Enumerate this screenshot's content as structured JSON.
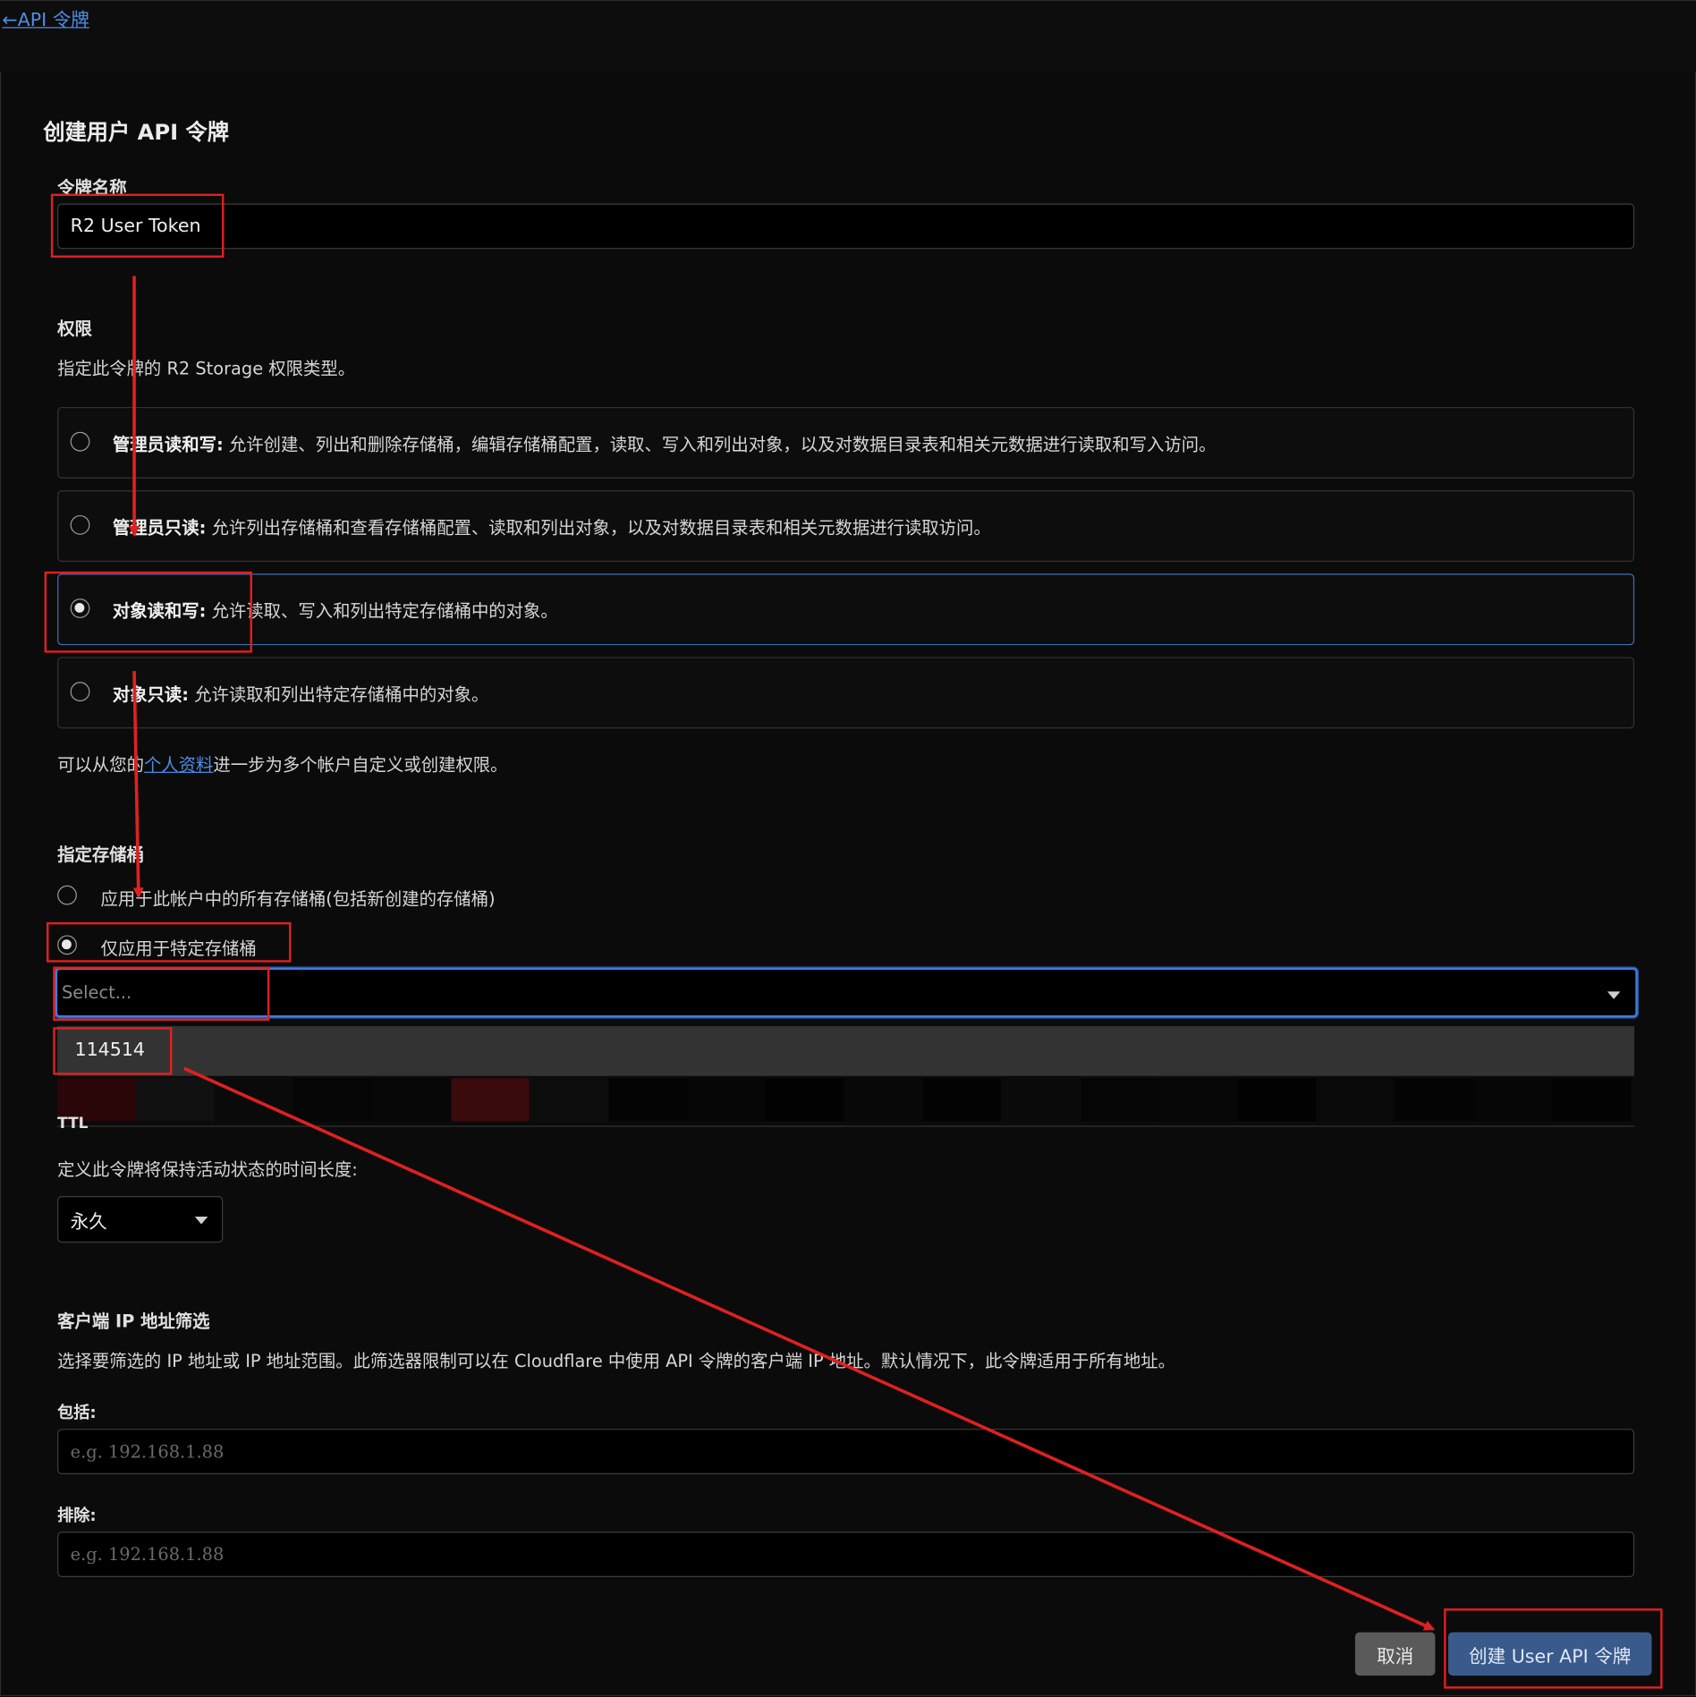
{
  "header": {
    "back_link": "←API 令牌"
  },
  "form": {
    "title": "创建用户 API 令牌",
    "token_name": {
      "label": "令牌名称",
      "value": "R2 User Token"
    },
    "permissions": {
      "label": "权限",
      "description": "指定此令牌的 R2 Storage 权限类型。",
      "options": [
        {
          "title": "管理员读和写:",
          "desc": " 允许创建、列出和删除存储桶，编辑存储桶配置，读取、写入和列出对象，以及对数据目录表和相关元数据进行读取和写入访问。",
          "selected": false
        },
        {
          "title": "管理员只读:",
          "desc": " 允许列出存储桶和查看存储桶配置、读取和列出对象，以及对数据目录表和相关元数据进行读取访问。",
          "selected": false
        },
        {
          "title": "对象读和写:",
          "desc": " 允许读取、写入和列出特定存储桶中的对象。",
          "selected": true
        },
        {
          "title": "对象只读:",
          "desc": " 允许读取和列出特定存储桶中的对象。",
          "selected": false
        }
      ],
      "note_prefix": "可以从您的",
      "note_link": "个人资料",
      "note_suffix": "进一步为多个帐户自定义或创建权限。"
    },
    "buckets": {
      "label": "指定存储桶",
      "option_all": "应用于此帐户中的所有存储桶(包括新创建的存储桶)",
      "option_specific": "仅应用于特定存储桶",
      "select_placeholder": "Select...",
      "dropdown_items": [
        "114514"
      ]
    },
    "ttl": {
      "label": "TTL",
      "description": "定义此令牌将保持活动状态的时间长度:",
      "selected": "永久"
    },
    "ip_filter": {
      "label": "客户端 IP 地址筛选",
      "description": "选择要筛选的 IP 地址或 IP 地址范围。此筛选器限制可以在 Cloudflare 中使用 API 令牌的客户端 IP 地址。默认情况下，此令牌适用于所有地址。",
      "include_label": "包括:",
      "include_placeholder": "e.g. 192.168.1.88",
      "exclude_label": "排除:",
      "exclude_placeholder": "e.g. 192.168.1.88"
    },
    "actions": {
      "cancel": "取消",
      "create": "创建 User API 令牌"
    }
  },
  "colors": {
    "background": "#0b0b0b",
    "link": "#4d8ee8",
    "primary_button": "#3a5a8c",
    "cancel_button": "#5a5a5a",
    "annotation": "#e02020"
  }
}
